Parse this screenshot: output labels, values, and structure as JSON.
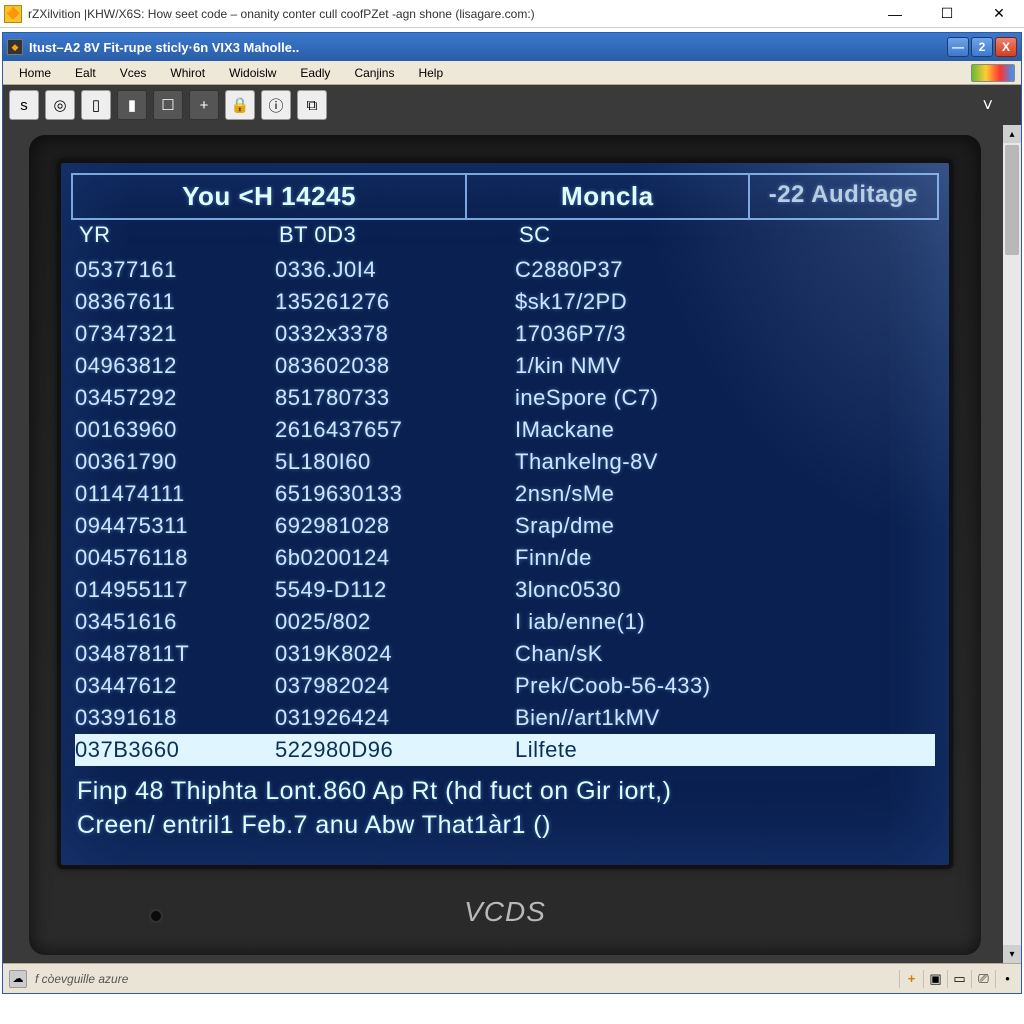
{
  "outer": {
    "title": "rZXilvition |KHW/X6S: How seet code – onanity conter cull coofPZet -agn shone (lisagare.com:)",
    "favicon_glyph": "🔶"
  },
  "inner": {
    "title": "Itust–A2 8V Fit-rupe sticly·6n VIX3 Maholle..",
    "minimize_glyph": "—",
    "restore_glyph": "2",
    "close_glyph": "X"
  },
  "menu": {
    "items": [
      "Home",
      "Ealt",
      "Vces",
      "Whirot",
      "Widoislw",
      "Eadly",
      "Canjins",
      "Help"
    ]
  },
  "toolbar": {
    "items": [
      {
        "name": "home-icon",
        "glyph": "s",
        "dark": false
      },
      {
        "name": "globe-icon",
        "glyph": "◎",
        "dark": false
      },
      {
        "name": "flag-icon",
        "glyph": "▯",
        "dark": false
      },
      {
        "name": "device-icon",
        "glyph": "▮",
        "dark": true
      },
      {
        "name": "edit-icon",
        "glyph": "☐",
        "dark": true
      },
      {
        "name": "add-icon",
        "glyph": "+",
        "dark": true
      },
      {
        "name": "lock-icon",
        "glyph": "🔒",
        "dark": false
      },
      {
        "name": "info-icon",
        "glyph": "ⓘ",
        "dark": false
      },
      {
        "name": "copy-icon",
        "glyph": "⧉",
        "dark": false
      }
    ],
    "chevron": "˅"
  },
  "screen": {
    "tabs": [
      {
        "label": "You <H  14245"
      },
      {
        "label": "Moncla"
      },
      {
        "label": "-22  Auditage"
      }
    ],
    "columns": [
      "YR",
      "BT     0D3",
      "SC"
    ],
    "rows": [
      {
        "c1": "05377161",
        "c2": "0336.J0I4",
        "c3": "C2880P37"
      },
      {
        "c1": "08367611",
        "c2": "135261276",
        "c3": "$sk17/2PD"
      },
      {
        "c1": "07347321",
        "c2": "0332x3378",
        "c3": "17036P7/3"
      },
      {
        "c1": "04963812",
        "c2": "083602038",
        "c3": "1/kin NMV"
      },
      {
        "c1": "03457292",
        "c2": "851780733",
        "c3": "ineSpore (C7)"
      },
      {
        "c1": "00163960",
        "c2": "2616437657",
        "c3": "IMackane"
      },
      {
        "c1": "00361790",
        "c2": "5L180I60",
        "c3": "Thankelng-8V"
      },
      {
        "c1": "011474111",
        "c2": "6519630133",
        "c3": "2nsn/sMe"
      },
      {
        "c1": "094475311",
        "c2": "692981028",
        "c3": "Srap/dme"
      },
      {
        "c1": "004576118",
        "c2": "6b0200124",
        "c3": "Finn/de"
      },
      {
        "c1": "014955117",
        "c2": "5549-D112",
        "c3": "3lonc0530"
      },
      {
        "c1": "03451616",
        "c2": "0025/802",
        "c3": "I iab/enne(1)"
      },
      {
        "c1": "03487811T",
        "c2": "0319K8024",
        "c3": "Chan/sK"
      },
      {
        "c1": "03447612",
        "c2": "037982024",
        "c3": "Prek/Coob-56-433)"
      },
      {
        "c1": "03391618",
        "c2": "031926424",
        "c3": "Bien//art1kMV"
      },
      {
        "c1": "037B3660",
        "c2": "522980D96",
        "c3": "Lilfete",
        "selected": true
      }
    ],
    "footer1": "Finp 48 Thiphta Lont.860 Ap Rt (hd fuct on Gir iort,)",
    "footer2": "Creen/ entril1 Feb.7 anu Abw That1àr1 ()",
    "brand": "VCDS"
  },
  "status": {
    "text": "f còevguille azure",
    "tray": [
      {
        "name": "add-tray-icon",
        "glyph": "+"
      },
      {
        "name": "camera-tray-icon",
        "glyph": "▣"
      },
      {
        "name": "folder-tray-icon",
        "glyph": "▭"
      },
      {
        "name": "panel-tray-icon",
        "glyph": "⎚"
      },
      {
        "name": "dot-tray-icon",
        "glyph": "•"
      }
    ]
  }
}
